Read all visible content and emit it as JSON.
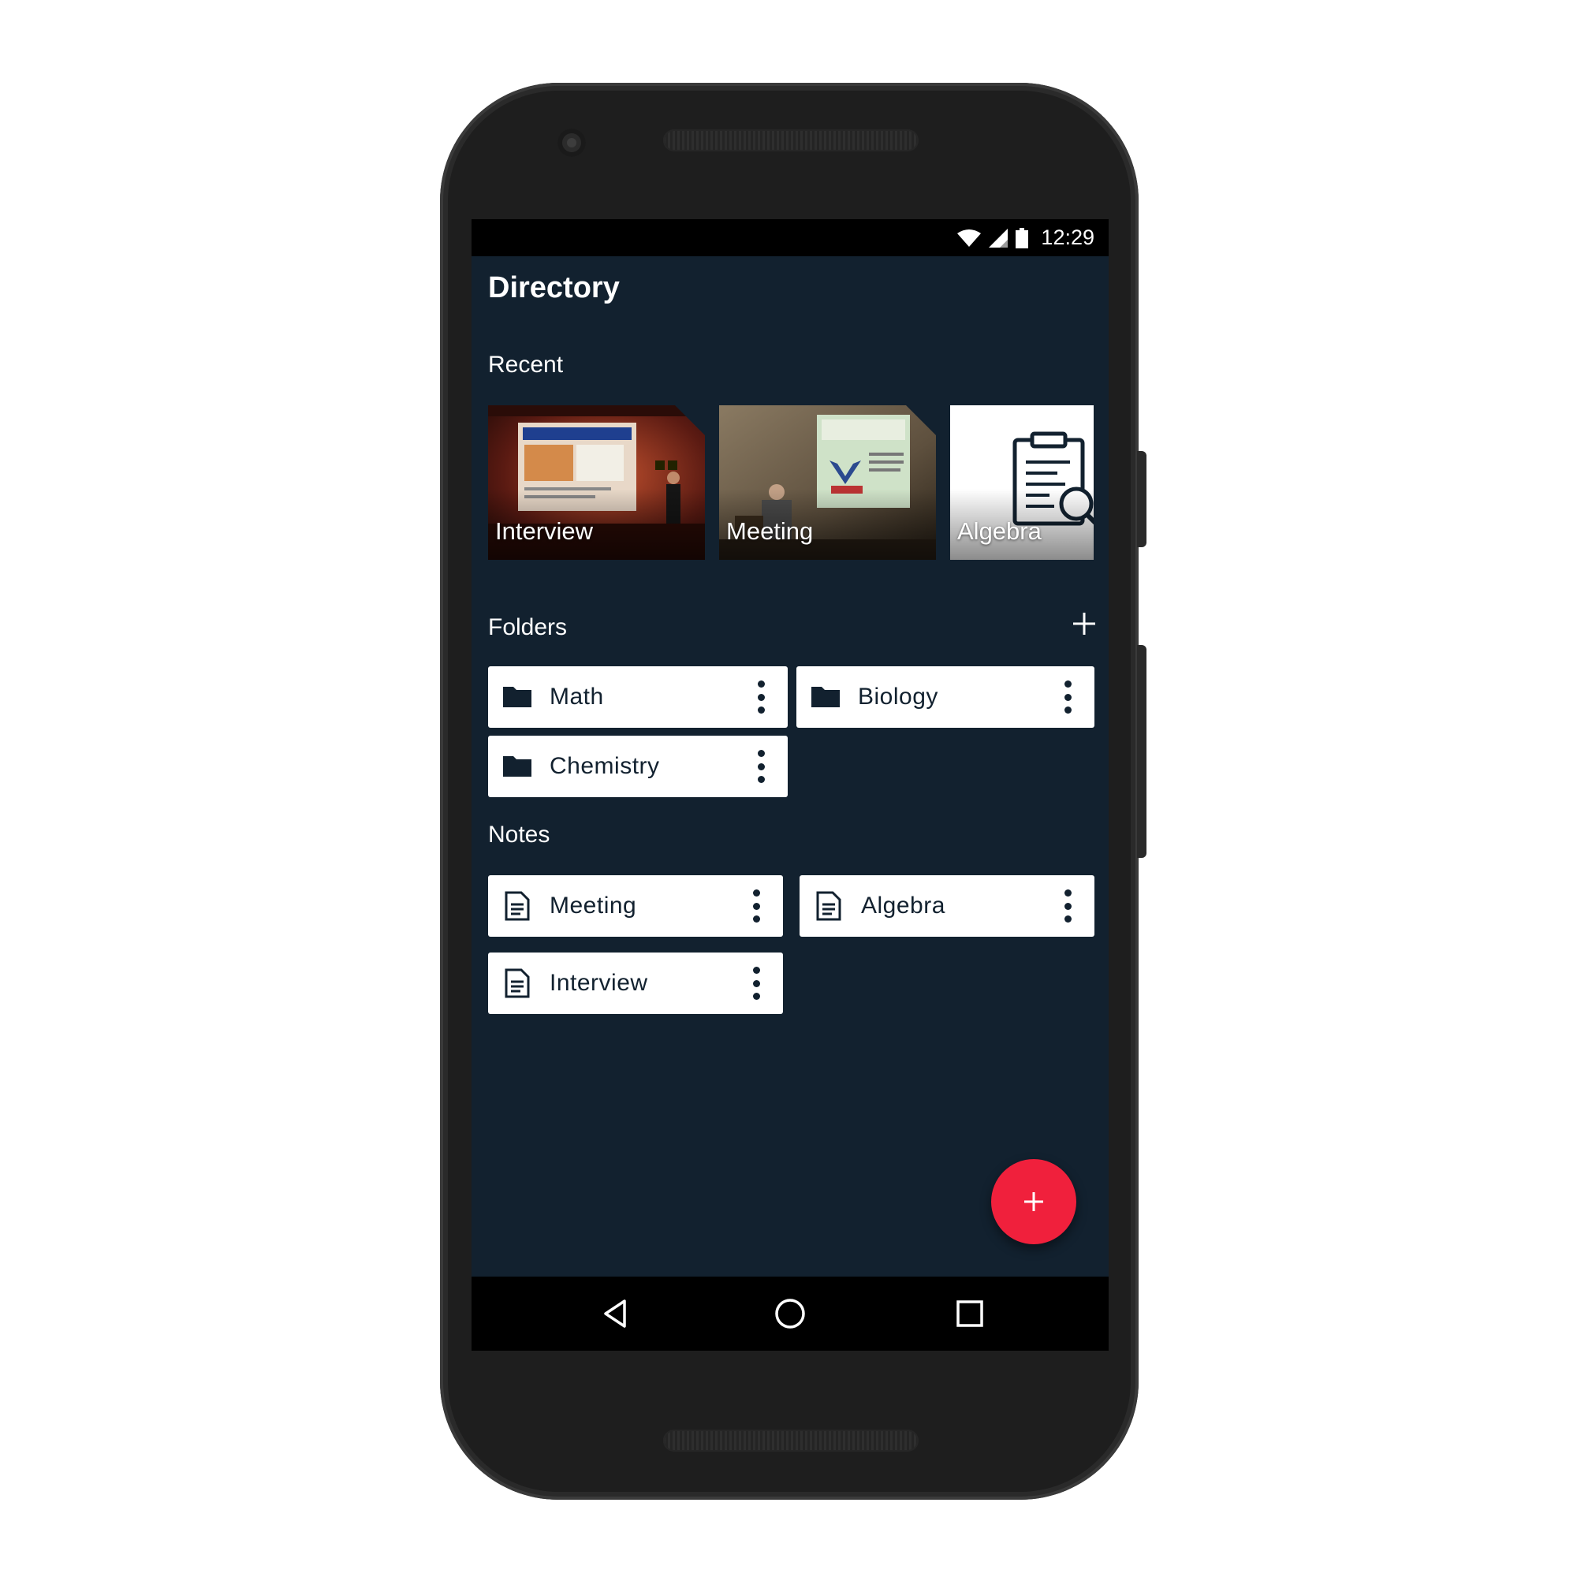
{
  "status_bar": {
    "time": "12:29"
  },
  "header": {
    "title": "Directory"
  },
  "recent": {
    "label": "Recent",
    "items": [
      {
        "label": "Interview",
        "kind": "photo"
      },
      {
        "label": "Meeting",
        "kind": "photo"
      },
      {
        "label": "Algebra",
        "kind": "document"
      }
    ]
  },
  "folders": {
    "label": "Folders",
    "items": [
      {
        "label": "Math"
      },
      {
        "label": "Biology"
      },
      {
        "label": "Chemistry"
      }
    ]
  },
  "notes": {
    "label": "Notes",
    "items": [
      {
        "label": "Meeting"
      },
      {
        "label": "Algebra"
      },
      {
        "label": "Interview"
      }
    ]
  },
  "colors": {
    "background": "#12212f",
    "card": "#ffffff",
    "accent": "#f0203c",
    "text_on_card": "#12212f"
  },
  "icons": {
    "folder": "folder-icon",
    "note": "document-icon",
    "more": "more-vert-icon",
    "add": "plus-icon"
  }
}
